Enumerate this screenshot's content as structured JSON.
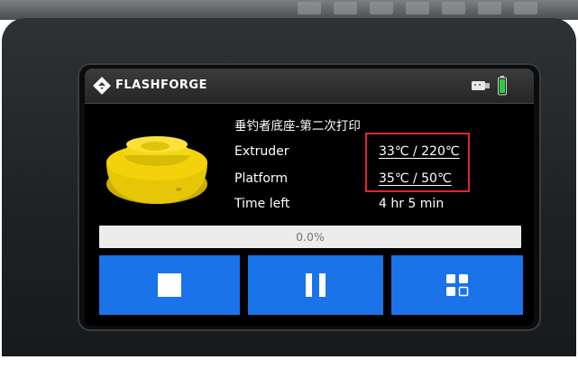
{
  "header": {
    "brand": "FLASHFORGE",
    "logo_icon": "flashforge-logo-icon",
    "usb_icon": "usb-icon",
    "battery_icon": "battery-icon",
    "battery_color": "#2ecc40"
  },
  "job": {
    "file_name": "垂钓者底座-第二次打印",
    "thumbnail_icon": "3d-model-thumbnail",
    "thumbnail_color": "#f2d20a"
  },
  "status": {
    "extruder_label": "Extruder",
    "extruder_value": "33℃ / 220℃",
    "platform_label": "Platform",
    "platform_value": "35℃ / 50℃",
    "time_left_label": "Time left",
    "time_left_value": "4 hr 5 min"
  },
  "progress": {
    "text": "0.0%",
    "percent": 0
  },
  "controls": {
    "stop_icon": "stop-icon",
    "pause_icon": "pause-icon",
    "more_icon": "grid-menu-icon",
    "button_color": "#1a73e8"
  },
  "annotation": {
    "highlight_color": "#e3262b"
  }
}
